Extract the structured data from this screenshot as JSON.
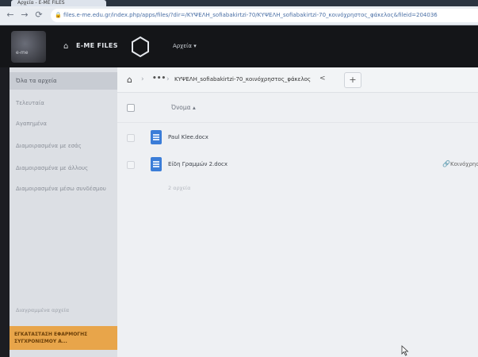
{
  "browser": {
    "tab_title": "Αρχεία - E-ME FILES",
    "url": "files.e-me.edu.gr/index.php/apps/files/?dir=/ΚΥΨΕΛΗ_sofiabakirtzi-70/ΚΥΨΕΛΗ_sofiabakirtzi-70_κοινόχρηστος_φάκελος&fileid=204036"
  },
  "header": {
    "logo_text": "e-me",
    "app_name": "E-ME FILES",
    "files_menu": "Αρχεία ▾"
  },
  "sidebar": {
    "items": [
      {
        "label": "Όλα τα αρχεία"
      },
      {
        "label": "Τελευταία"
      },
      {
        "label": "Αγαπημένα"
      },
      {
        "label": "Διαμοιρασμένα με εσάς"
      },
      {
        "label": "Διαμοιρασμένα με άλλους"
      },
      {
        "label": "Διαμοιρασμένα μέσω συνδέσμου"
      }
    ],
    "deleted": "Διαγραμμένα αρχεία",
    "sync_banner": "ΕΓΚΑΤΑΣΤΑΣΗ ΕΦΑΡΜΟΓΗΣ ΣΥΓΧΡΟΝΙΣΜΟΥ Α..."
  },
  "breadcrumb": {
    "dots": "•••",
    "folder": "ΚΥΨΕΛΗ_sofiabakirtzi-70_κοινόχρηστος_φάκελος",
    "add": "+"
  },
  "table": {
    "column_name": "Όνομα ▴",
    "files": [
      {
        "name": "Paul Klee.docx",
        "shared_label": ""
      },
      {
        "name": "Είδη Γραμμών 2.docx",
        "shared_label": "Κοινόχρησ"
      }
    ],
    "count": "2 αρχεία"
  },
  "colors": {
    "header_bg": "#141518",
    "sidebar_bg": "#dcdfe4",
    "accent": "#3b7dd8",
    "sync_banner": "#e8a54a"
  }
}
